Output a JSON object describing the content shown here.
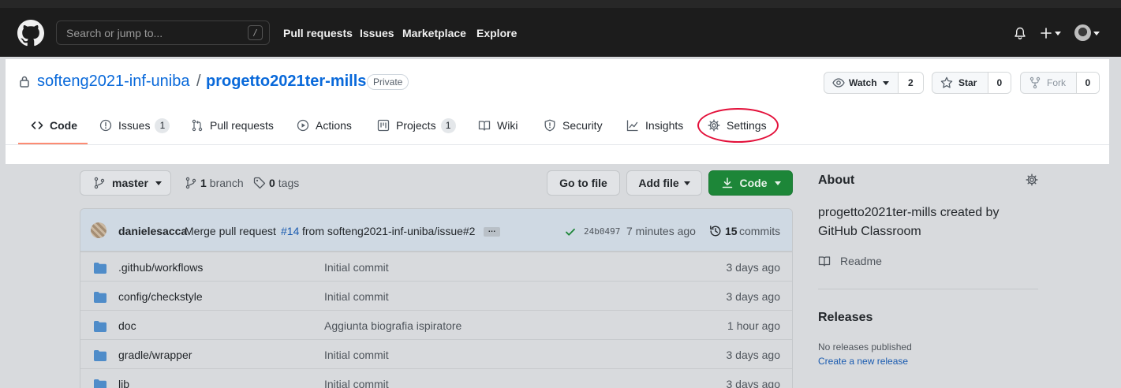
{
  "header": {
    "search_placeholder": "Search or jump to...",
    "search_shortcut": "/",
    "nav": [
      "Pull requests",
      "Issues",
      "Marketplace",
      "Explore"
    ]
  },
  "repo": {
    "owner": "softeng2021-inf-uniba",
    "separator": "/",
    "name": "progetto2021ter-mills",
    "visibility": "Private",
    "watch_label": "Watch",
    "watch_count": "2",
    "star_label": "Star",
    "star_count": "0",
    "fork_label": "Fork",
    "fork_count": "0"
  },
  "tabs": [
    {
      "label": "Code",
      "count": null
    },
    {
      "label": "Issues",
      "count": "1"
    },
    {
      "label": "Pull requests",
      "count": null
    },
    {
      "label": "Actions",
      "count": null
    },
    {
      "label": "Projects",
      "count": "1"
    },
    {
      "label": "Wiki",
      "count": null
    },
    {
      "label": "Security",
      "count": null
    },
    {
      "label": "Insights",
      "count": null
    },
    {
      "label": "Settings",
      "count": null
    }
  ],
  "toolbar": {
    "branch": "master",
    "branch_count": "1",
    "branch_word": "branch",
    "tag_count": "0",
    "tag_word": "tags",
    "go_to_file": "Go to file",
    "add_file": "Add file",
    "code": "Code"
  },
  "commit": {
    "author": "danielesacca",
    "message_prefix": "Merge pull request",
    "pr_link": "#14",
    "message_suffix": "from softeng2021-inf-uniba/issue#2",
    "ellipsis": "…",
    "sha": "24b0497",
    "time": "7 minutes ago",
    "commit_count": "15",
    "commit_word": "commits"
  },
  "files": [
    {
      "name": ".github/workflows",
      "message": "Initial commit",
      "age": "3 days ago"
    },
    {
      "name": "config/checkstyle",
      "message": "Initial commit",
      "age": "3 days ago"
    },
    {
      "name": "doc",
      "message": "Aggiunta biografia ispiratore",
      "age": "1 hour ago"
    },
    {
      "name": "gradle/wrapper",
      "message": "Initial commit",
      "age": "3 days ago"
    },
    {
      "name": "lib",
      "message": "Initial commit",
      "age": "3 days ago"
    }
  ],
  "sidebar": {
    "about_title": "About",
    "about_text": "progetto2021ter-mills created by GitHub Classroom",
    "readme": "Readme",
    "releases_title": "Releases",
    "releases_text": "No releases published",
    "releases_link": "Create a new release"
  },
  "colors": {
    "highlight_ellipse": "#e3103a",
    "link_blue": "#0969da",
    "tab_underline": "#fd8c73",
    "code_button_green": "#1d8638"
  }
}
